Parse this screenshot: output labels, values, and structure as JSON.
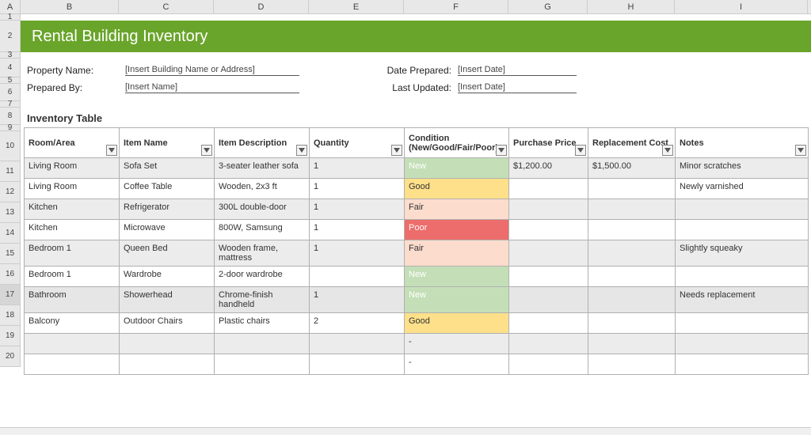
{
  "columns": [
    "A",
    "B",
    "C",
    "D",
    "E",
    "F",
    "G",
    "H",
    "I"
  ],
  "row_labels": [
    "1",
    "2",
    "3",
    "4",
    "5",
    "6",
    "7",
    "8",
    "9",
    "10",
    "11",
    "12",
    "13",
    "14",
    "15",
    "16",
    "17",
    "18",
    "19",
    "20"
  ],
  "title": "Rental Building Inventory",
  "meta": {
    "property_name_label": "Property Name:",
    "property_name_value": "[Insert Building Name or Address]",
    "prepared_by_label": "Prepared By:",
    "prepared_by_value": "[Insert Name]",
    "date_prepared_label": "Date Prepared:",
    "date_prepared_value": "[Insert Date]",
    "last_updated_label": "Last Updated:",
    "last_updated_value": "[Insert Date]"
  },
  "section_title": "Inventory Table",
  "headers": {
    "room": "Room/Area",
    "item": "Item Name",
    "desc": "Item Description",
    "qty": "Quantity",
    "cond": "Condition (New/Good/Fair/Poor)",
    "price": "Purchase Price",
    "repl": "Replacement Cost",
    "notes": "Notes"
  },
  "rows": [
    {
      "room": "Living Room",
      "item": "Sofa Set",
      "desc": "3-seater leather sofa",
      "qty": "1",
      "cond": "New",
      "price": "$1,200.00",
      "repl": "$1,500.00",
      "notes": "Minor scratches",
      "cond_class": "cond-new",
      "striped": true
    },
    {
      "room": "Living Room",
      "item": "Coffee Table",
      "desc": "Wooden, 2x3 ft",
      "qty": "1",
      "cond": "Good",
      "price": "",
      "repl": "",
      "notes": "Newly varnished",
      "cond_class": "cond-good",
      "striped": false
    },
    {
      "room": "Kitchen",
      "item": "Refrigerator",
      "desc": "300L double-door",
      "qty": "1",
      "cond": "Fair",
      "price": "",
      "repl": "",
      "notes": "",
      "cond_class": "cond-fair",
      "striped": true
    },
    {
      "room": "Kitchen",
      "item": "Microwave",
      "desc": "800W, Samsung",
      "qty": "1",
      "cond": "Poor",
      "price": "",
      "repl": "",
      "notes": "",
      "cond_class": "cond-poor",
      "striped": false
    },
    {
      "room": "Bedroom 1",
      "item": "Queen Bed",
      "desc": "Wooden frame, mattress",
      "qty": "1",
      "cond": "Fair",
      "price": "",
      "repl": "",
      "notes": "Slightly squeaky",
      "cond_class": "cond-fair",
      "striped": true
    },
    {
      "room": "Bedroom 1",
      "item": "Wardrobe",
      "desc": "2-door wardrobe",
      "qty": "",
      "cond": "New",
      "price": "",
      "repl": "",
      "notes": "",
      "cond_class": "cond-new",
      "striped": false
    },
    {
      "room": "Bathroom",
      "item": "Showerhead",
      "desc": "Chrome-finish handheld",
      "qty": "1",
      "cond": "New",
      "price": "",
      "repl": "",
      "notes": "Needs replacement",
      "cond_class": "cond-new",
      "striped": true,
      "selected": true
    },
    {
      "room": "Balcony",
      "item": "Outdoor Chairs",
      "desc": "Plastic chairs",
      "qty": "2",
      "cond": "Good",
      "price": "",
      "repl": "",
      "notes": "",
      "cond_class": "cond-good",
      "striped": false
    },
    {
      "room": "",
      "item": "",
      "desc": "",
      "qty": "",
      "cond": "-",
      "price": "",
      "repl": "",
      "notes": "",
      "cond_class": "",
      "striped": true
    },
    {
      "room": "",
      "item": "",
      "desc": "",
      "qty": "",
      "cond": "-",
      "price": "",
      "repl": "",
      "notes": "",
      "cond_class": "",
      "striped": false
    }
  ],
  "chart_data": {
    "type": "table",
    "title": "Rental Building Inventory",
    "columns": [
      "Room/Area",
      "Item Name",
      "Item Description",
      "Quantity",
      "Condition (New/Good/Fair/Poor)",
      "Purchase Price",
      "Replacement Cost",
      "Notes"
    ],
    "rows": [
      [
        "Living Room",
        "Sofa Set",
        "3-seater leather sofa",
        1,
        "New",
        "$1,200.00",
        "$1,500.00",
        "Minor scratches"
      ],
      [
        "Living Room",
        "Coffee Table",
        "Wooden, 2x3 ft",
        1,
        "Good",
        "",
        "",
        "Newly varnished"
      ],
      [
        "Kitchen",
        "Refrigerator",
        "300L double-door",
        1,
        "Fair",
        "",
        "",
        ""
      ],
      [
        "Kitchen",
        "Microwave",
        "800W, Samsung",
        1,
        "Poor",
        "",
        "",
        ""
      ],
      [
        "Bedroom 1",
        "Queen Bed",
        "Wooden frame, mattress",
        1,
        "Fair",
        "",
        "",
        "Slightly squeaky"
      ],
      [
        "Bedroom 1",
        "Wardrobe",
        "2-door wardrobe",
        "",
        "New",
        "",
        "",
        ""
      ],
      [
        "Bathroom",
        "Showerhead",
        "Chrome-finish handheld",
        1,
        "New",
        "",
        "",
        "Needs replacement"
      ],
      [
        "Balcony",
        "Outdoor Chairs",
        "Plastic chairs",
        2,
        "Good",
        "",
        "",
        ""
      ]
    ]
  }
}
